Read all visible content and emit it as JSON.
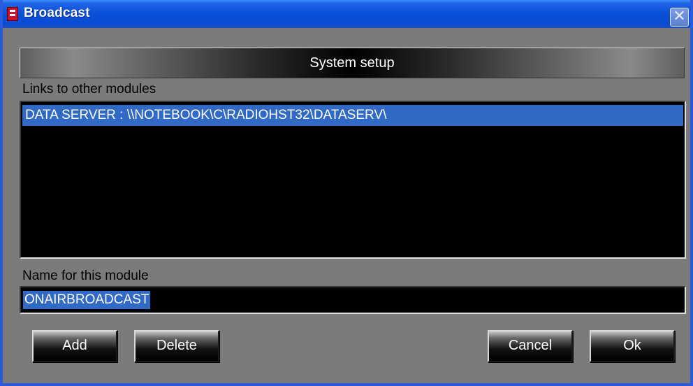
{
  "window": {
    "title": "Broadcast"
  },
  "header": {
    "title": "System setup"
  },
  "links": {
    "label": "Links to other modules",
    "items": [
      "DATA SERVER : \\\\NOTEBOOK\\C\\RADIOHST32\\DATASERV\\"
    ]
  },
  "module_name": {
    "label": "Name for this module",
    "value": "ONAIRBROADCAST"
  },
  "buttons": {
    "add": "Add",
    "delete": "Delete",
    "cancel": "Cancel",
    "ok": "Ok"
  },
  "icons": {
    "app": "app-icon",
    "close": "close-icon"
  },
  "colors": {
    "titlebar": "#0a4fd8",
    "selection": "#3169c6",
    "background": "#7b7b7b"
  }
}
